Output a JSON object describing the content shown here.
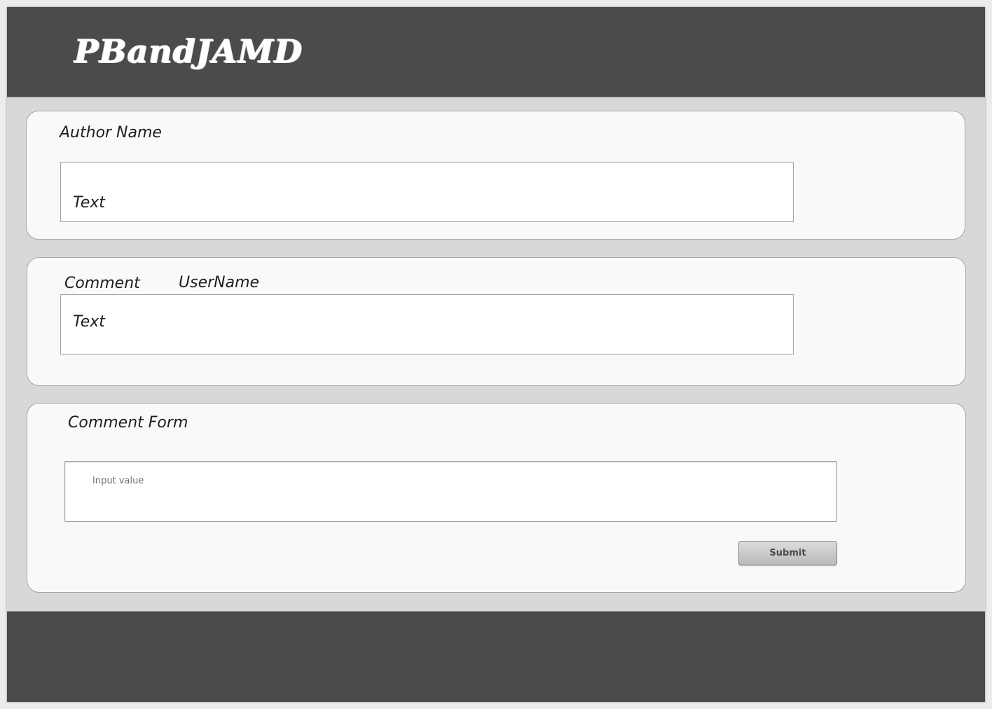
{
  "header": {
    "brand": "PBandJAMD"
  },
  "author_panel": {
    "label": "Author Name",
    "text_value": "Text"
  },
  "comment_panel": {
    "comment_label": "Comment",
    "username_label": "UserName",
    "text_value": "Text"
  },
  "comment_form": {
    "title": "Comment Form",
    "input_placeholder": "Input value",
    "submit_label": "Submit"
  },
  "colors": {
    "header_bg": "#4b4b4b",
    "footer_bg": "#4b4b4b",
    "page_bg": "#d8d8d8",
    "panel_bg": "#f9f9f9"
  }
}
